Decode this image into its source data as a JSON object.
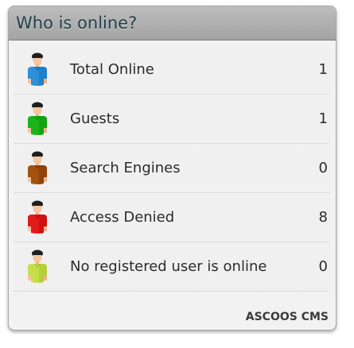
{
  "widget": {
    "title": "Who is online?",
    "footer": "ASCOOS CMS"
  },
  "rows": [
    {
      "label": "Total Online",
      "count": "1",
      "icon": "user-blue-icon",
      "color": "#2f8fd8"
    },
    {
      "label": "Guests",
      "count": "1",
      "icon": "user-green-icon",
      "color": "#1bb31b"
    },
    {
      "label": "Search Engines",
      "count": "0",
      "icon": "user-brown-icon",
      "color": "#a0520e"
    },
    {
      "label": "Access Denied",
      "count": "8",
      "icon": "user-red-icon",
      "color": "#e11a1a"
    },
    {
      "label": "No registered user is online",
      "count": "0",
      "icon": "user-yellow-icon",
      "color": "#c6de4a"
    }
  ]
}
